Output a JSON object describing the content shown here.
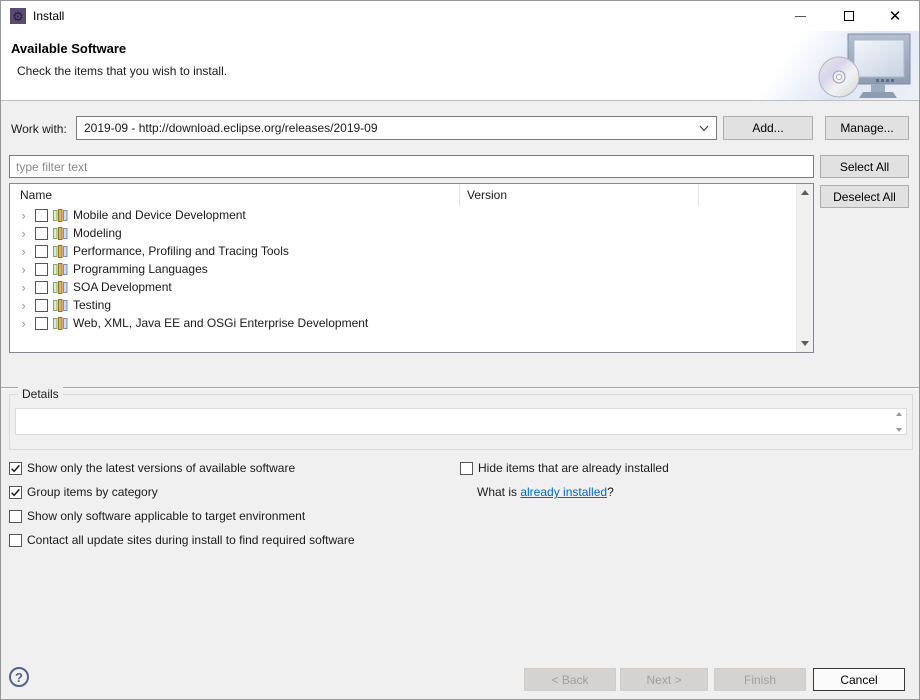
{
  "window": {
    "title": "Install"
  },
  "header": {
    "title": "Available Software",
    "subtitle": "Check the items that you wish to install."
  },
  "work_with": {
    "label": "Work with:",
    "value": "2019-09 - http://download.eclipse.org/releases/2019-09",
    "add": "Add...",
    "manage": "Manage..."
  },
  "filter": {
    "placeholder": "type filter text"
  },
  "actions": {
    "select_all": "Select All",
    "deselect_all": "Deselect All"
  },
  "tree": {
    "columns": [
      "Name",
      "Version"
    ],
    "rows": [
      {
        "name": "Mobile and Device Development",
        "version": ""
      },
      {
        "name": "Modeling",
        "version": ""
      },
      {
        "name": "Performance, Profiling and Tracing Tools",
        "version": ""
      },
      {
        "name": "Programming Languages",
        "version": ""
      },
      {
        "name": "SOA Development",
        "version": ""
      },
      {
        "name": "Testing",
        "version": ""
      },
      {
        "name": "Web, XML, Java EE and OSGi Enterprise Development",
        "version": ""
      }
    ]
  },
  "details": {
    "label": "Details",
    "content": ""
  },
  "options": {
    "left": [
      {
        "label": "Show only the latest versions of available software",
        "checked": true
      },
      {
        "label": "Group items by category",
        "checked": true
      },
      {
        "label": "Show only software applicable to target environment",
        "checked": false
      },
      {
        "label": "Contact all update sites during install to find required software",
        "checked": false
      }
    ],
    "right": [
      {
        "label": "Hide items that are already installed",
        "checked": false
      }
    ],
    "question": {
      "prefix": "What is ",
      "link": "already installed",
      "suffix": "?"
    }
  },
  "footer": {
    "help": "?",
    "back": "< Back",
    "next": "Next >",
    "finish": "Finish",
    "cancel": "Cancel"
  },
  "colors": {
    "link": "#0066cc",
    "app_icon_bg": "#5a4a78",
    "accent_border": "#7a7a7a"
  }
}
